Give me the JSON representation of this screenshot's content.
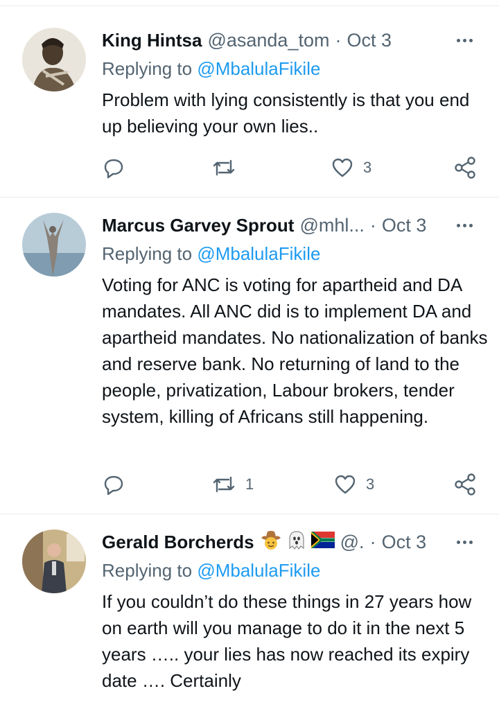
{
  "reply_prefix": "Replying to",
  "tweets": [
    {
      "name": "King Hintsa",
      "handle": "@asanda_tom",
      "separator": "·",
      "time": "Oct 3",
      "reply_to": "@MbalulaFikile",
      "text": "Problem with lying consistently is that you end up believing your own lies..",
      "replies": "",
      "retweets": "",
      "likes": "3"
    },
    {
      "name": "Marcus Garvey Sprout",
      "handle": "@mhl...",
      "separator": "·",
      "time": "Oct 3",
      "reply_to": "@MbalulaFikile",
      "text": "Voting for ANC is voting for apartheid and DA mandates. All ANC did is to implement DA and apartheid mandates. No nationalization of banks and reserve bank. No returning of land to the people, privatization, Labour brokers, tender system, killing of Africans still happening.",
      "replies": "",
      "retweets": "1",
      "likes": "3"
    },
    {
      "name": "Gerald Borcherds",
      "name_emoji": [
        "cowboy-face-emoji",
        "ghost-emoji",
        "south-africa-flag-emoji"
      ],
      "handle": "@.",
      "separator": "·",
      "time": "Oct 3",
      "reply_to": "@MbalulaFikile",
      "text": "If you couldn’t do these things in 27 years how on earth will you manage to do it in the next 5 years ….. your lies has now reached its expiry date …. Certainly",
      "replies": "",
      "retweets": "",
      "likes": ""
    }
  ],
  "colors": {
    "name": "#0f1419",
    "secondary": "#536471",
    "link": "#1d9bf0",
    "divider": "#e6ecf0"
  }
}
